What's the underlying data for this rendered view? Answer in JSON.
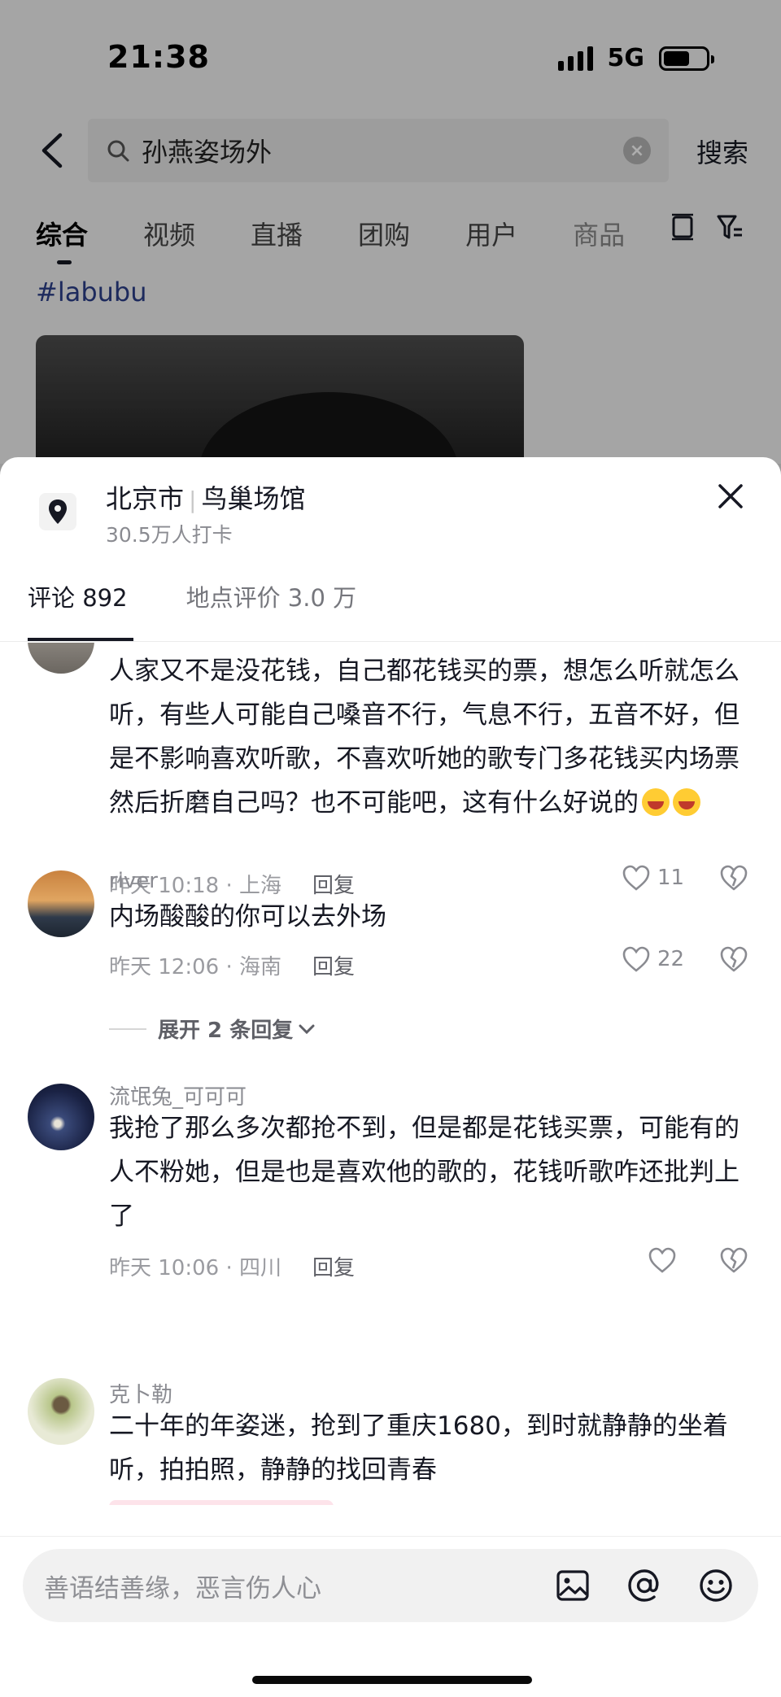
{
  "status_bar": {
    "time": "21:38",
    "network": "5G",
    "battery_level": 0.62
  },
  "search": {
    "query": "孙燕姿场外",
    "submit_label": "搜索"
  },
  "tabs": [
    {
      "label": "综合"
    },
    {
      "label": "视频"
    },
    {
      "label": "直播"
    },
    {
      "label": "团购"
    },
    {
      "label": "用户"
    },
    {
      "label": "商品"
    }
  ],
  "background": {
    "hashtag": "#labubu"
  },
  "location": {
    "city": "北京市",
    "venue": "鸟巢场馆",
    "checkins": "30.5万人打卡"
  },
  "comment_tabs": {
    "comments": "评论 892",
    "reviews": "地点评价 3.0 万"
  },
  "comments": [
    {
      "username": "",
      "text": "人家又不是没花钱，自己都花钱买的票，想怎么听就怎么听，有些人可能自己嗓音不行，气息不行，五音不好，但是不影响喜欢听歌，不喜欢听她的歌专门多花钱买内场票然后折磨自己吗？也不可能吧，这有什么好说的",
      "meta": "昨天 10:18 · 上海",
      "reply_label": "回复",
      "likes": "11"
    },
    {
      "username": "river",
      "text": "内场酸酸的你可以去外场",
      "meta": "昨天 12:06 · 海南",
      "reply_label": "回复",
      "likes": "22",
      "expand_label": "展开 2 条回复"
    },
    {
      "username": "流氓兔_可可可",
      "text": "我抢了那么多次都抢不到，但是都是花钱买票，可能有的人不粉她，但是也是喜欢他的歌的，花钱听歌咋还批判上了",
      "meta": "昨天 10:06 · 四川",
      "reply_label": "回复",
      "likes": ""
    },
    {
      "username": "克卜勒",
      "text": "二十年的年姿迷，抢到了重庆1680，到时就静静的坐着听，拍拍照，静静的找回青春",
      "meta": "",
      "reply_label": "",
      "likes": ""
    }
  ],
  "input": {
    "placeholder": "善语结善缘，恶言伤人心"
  },
  "icons": [
    "back-arrow-icon",
    "search-icon",
    "clear-icon",
    "layout-icon",
    "filter-icon",
    "location-pin-icon",
    "close-icon",
    "heart-icon",
    "broken-heart-icon",
    "chevron-down-icon",
    "image-icon",
    "at-icon",
    "emoji-icon"
  ]
}
